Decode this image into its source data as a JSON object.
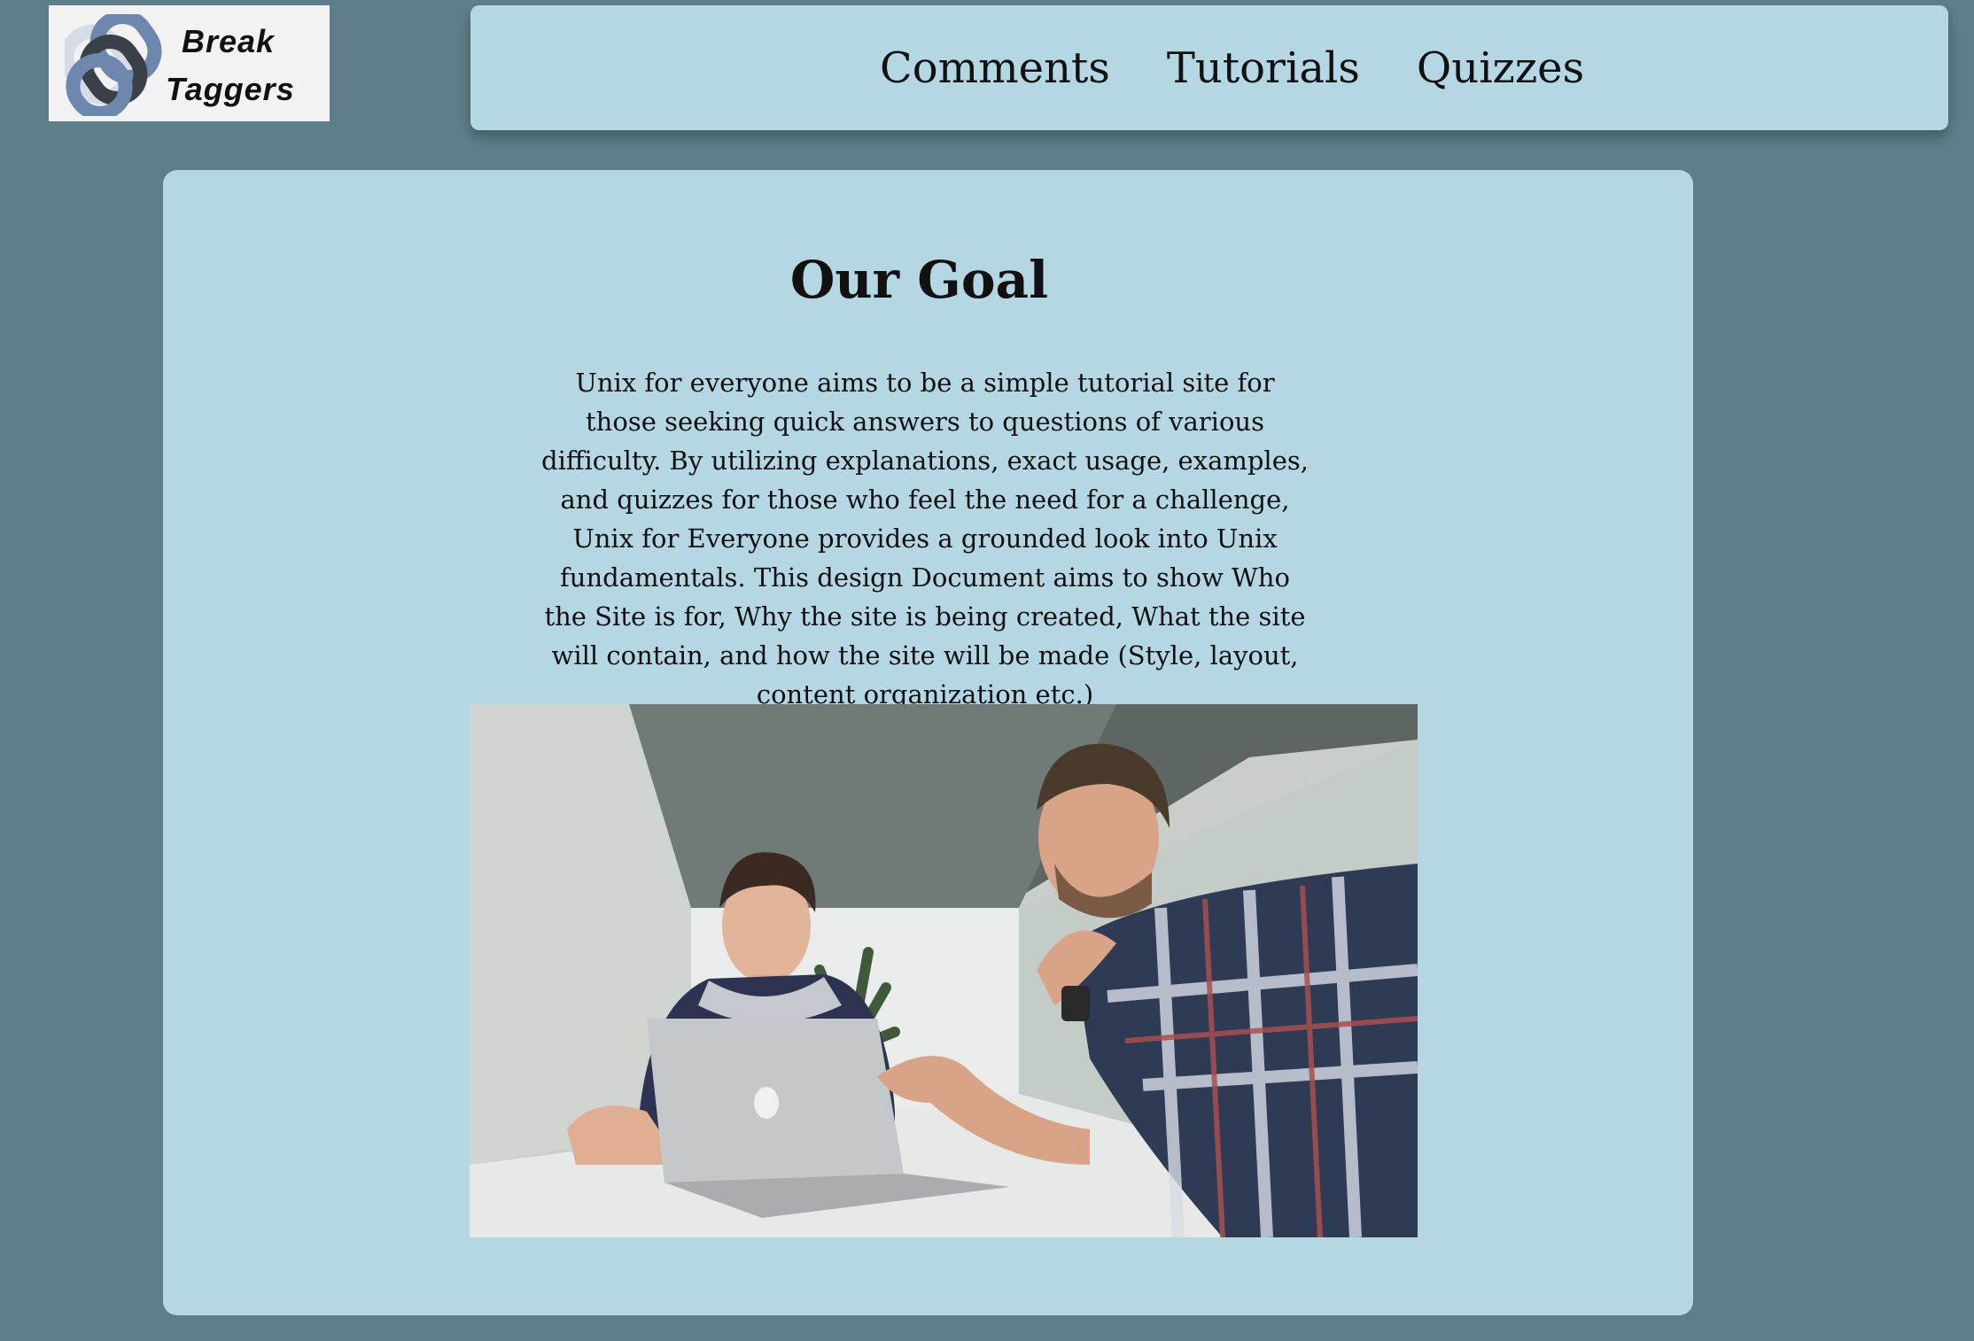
{
  "logo": {
    "line1": "Break",
    "line2": "Taggers",
    "icon": "chain-links-icon"
  },
  "nav": {
    "items": [
      {
        "label": "Comments"
      },
      {
        "label": "Tutorials"
      },
      {
        "label": "Quizzes"
      }
    ]
  },
  "main": {
    "title": "Our Goal",
    "body": "Unix for everyone aims to be a simple tutorial site for those seeking quick answers to questions of various difficulty. By utilizing explanations, exact usage, examples, and quizzes for those who feel the need for a challenge, Unix for Everyone provides a grounded look into Unix fundamentals. This design Document aims to show Who the Site is for, Why the site is being created, What the site will contain, and how the site will be made (Style, layout, content organization etc.)"
  },
  "colors": {
    "page_background": "#5e7f89",
    "panel_background": "#b5d7e3",
    "text": "#111111"
  }
}
